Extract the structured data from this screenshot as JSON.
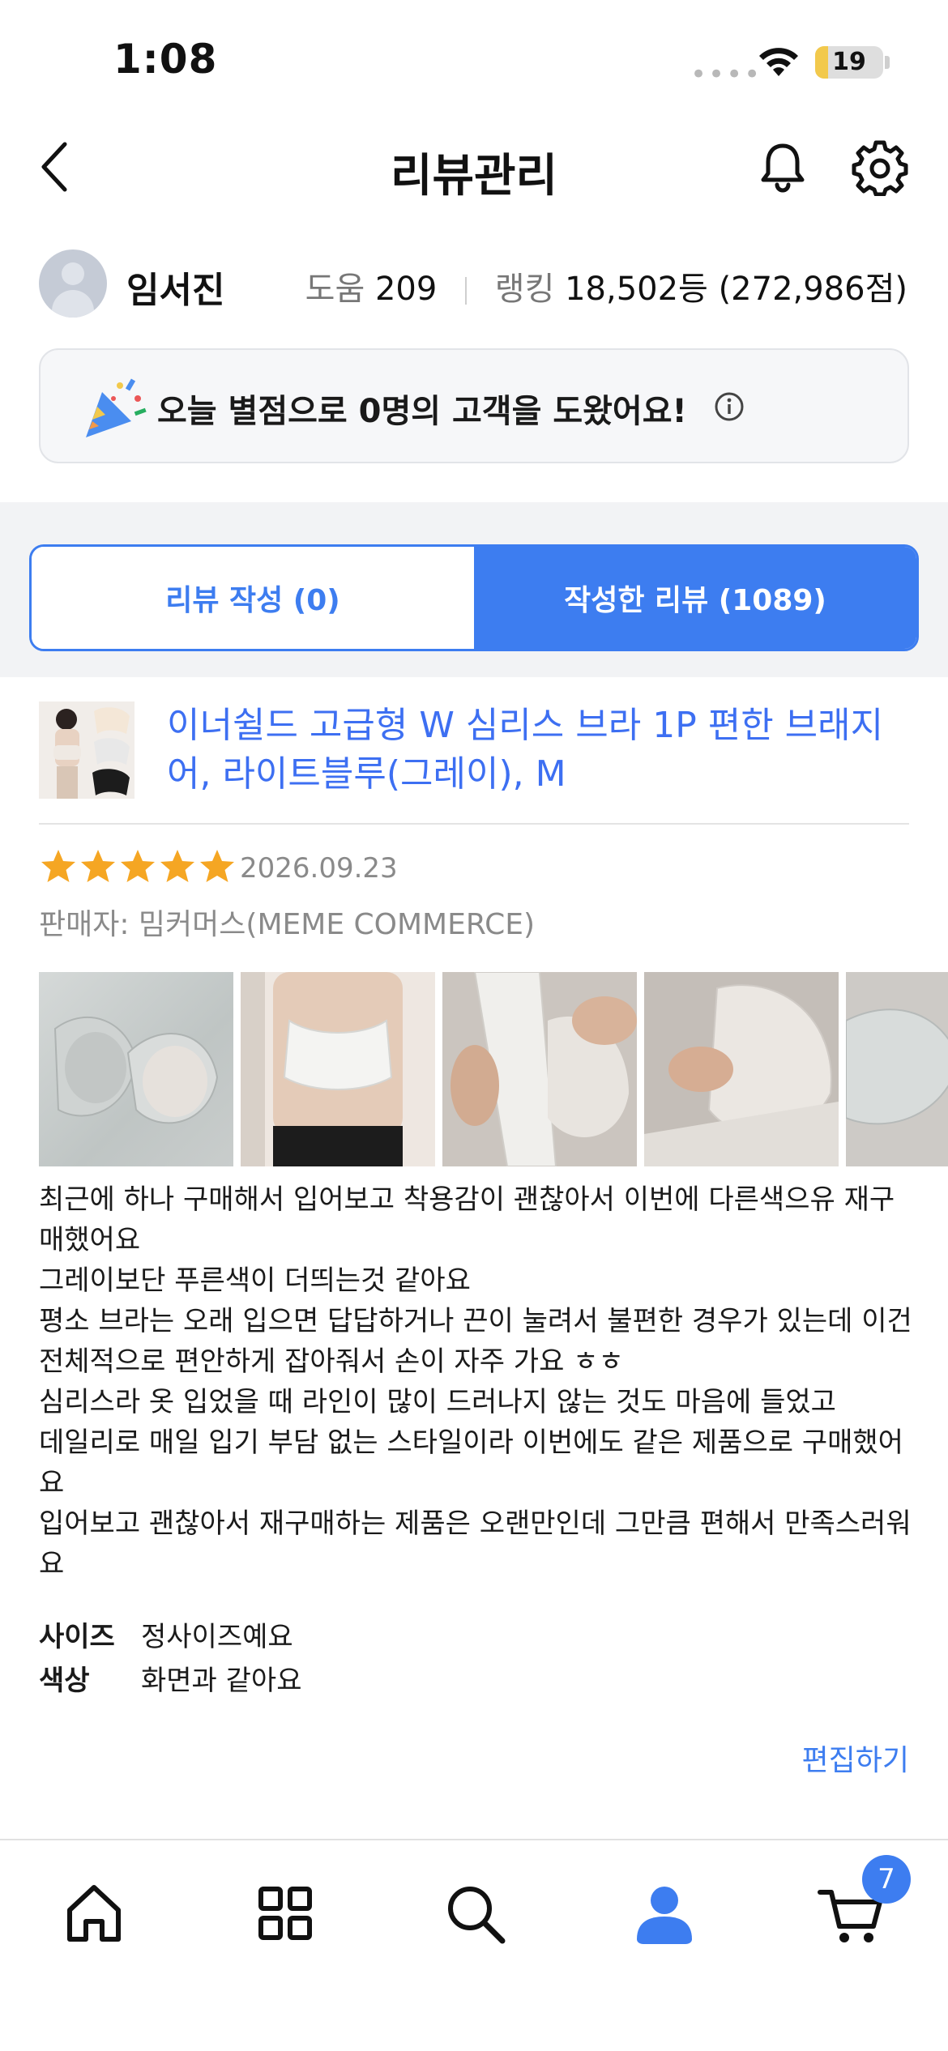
{
  "status_bar": {
    "time": "1:08",
    "battery": "19",
    "battery_level": 0.19
  },
  "header": {
    "title": "리뷰관리"
  },
  "profile": {
    "name": "임서진",
    "help_label": "도움",
    "help_value": "209",
    "rank_label": "랭킹",
    "rank_value": "18,502등 (272,986점)"
  },
  "banner": {
    "text": "오늘 별점으로 0명의 고객을 도왔어요!"
  },
  "tabs": [
    {
      "label": "리뷰 작성 (0)",
      "active": false
    },
    {
      "label": "작성한 리뷰 (1089)",
      "active": true
    }
  ],
  "review": {
    "product_title": "이너쉴드 고급형 W 심리스 브라 1P 편한 브래지어, 라이트블루(그레이), M",
    "rating": 5,
    "date": "2026.09.23",
    "seller": "판매자: 밈커머스(MEME COMMERCE)",
    "body_lines": [
      "최근에  하나 구매해서 입어보고 착용감이 괜찮아서 이번에 다른색으유 재구",
      "매했어요",
      "그레이보단 푸른색이 더띄는것 같아요",
      "평소 브라는 오래 입으면 답답하거나 끈이 눌려서 불편한 경우가 있는데 이건",
      "전체적으로 편안하게 잡아줘서 손이 자주 가요 ㅎㅎ",
      "심리스라 옷 입었을 때 라인이 많이 드러나지 않는 것도 마음에 들었고",
      "데일리로 매일 입기 부담 없는 스타일이라 이번에도 같은 제품으로 구매했어",
      "요",
      "입어보고 괜찮아서 재구매하는 제품은 오랜만인데 그만큼 편해서 만족스러워",
      "요"
    ],
    "attributes": [
      {
        "key": "사이즈",
        "value": "정사이즈예요"
      },
      {
        "key": "색상",
        "value": "화면과 같아요"
      }
    ],
    "edit_label": "편집하기"
  },
  "bottom_nav": {
    "items": [
      "home-icon",
      "category-grid-icon",
      "search-icon",
      "my-page-icon",
      "cart-icon"
    ],
    "cart_count": "7",
    "accent": "#3d7df0"
  }
}
